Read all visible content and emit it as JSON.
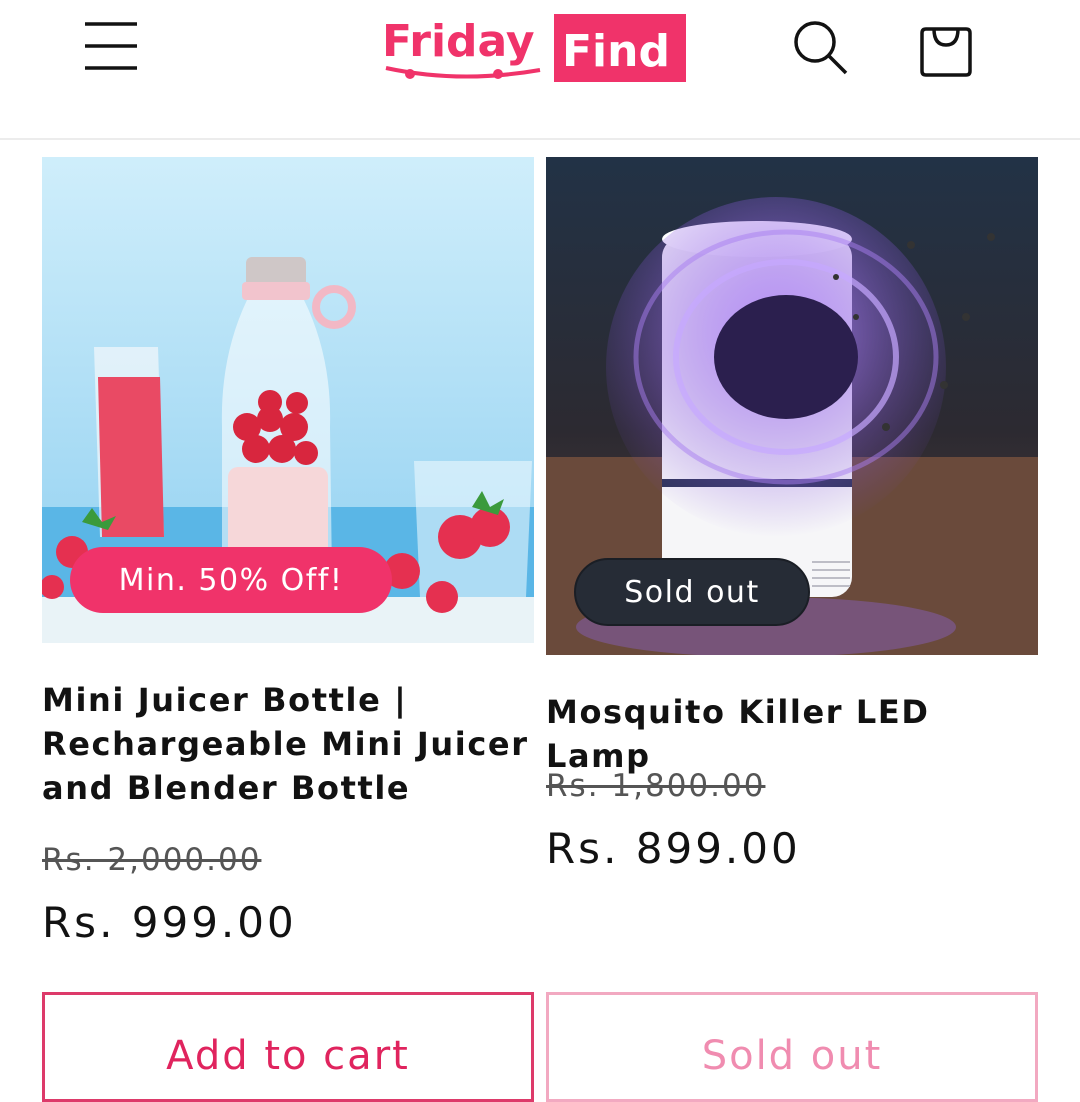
{
  "header": {
    "logo_text_1": "Friday",
    "logo_text_2": "Find",
    "menu_icon": "hamburger-menu-icon",
    "search_icon": "search-icon",
    "cart_icon": "shopping-bag-icon"
  },
  "products": [
    {
      "badge": "Min. 50% Off!",
      "title": "Mini Juicer Bottle | Rechargeable Mini Juicer and Blender Bottle",
      "old_price": "Rs. 2,000.00",
      "price": "Rs. 999.00",
      "button": "Add to cart"
    },
    {
      "badge": "Sold out",
      "title": "Mosquito Killer LED Lamp",
      "old_price": "Rs. 1,800.00",
      "price": "Rs. 899.00",
      "button": "Sold out"
    }
  ],
  "colors": {
    "brand": "#f0336a",
    "sold_badge": "#262c36",
    "sold_button_border": "#f2a9c1"
  }
}
